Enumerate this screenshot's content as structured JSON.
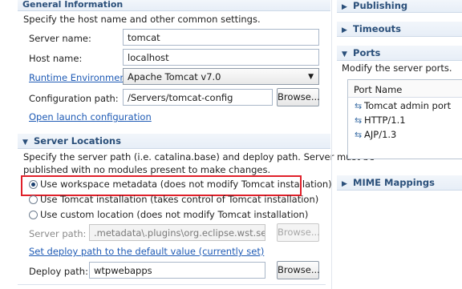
{
  "left": {
    "general": {
      "title": "General Information",
      "description": "Specify the host name and other common settings.",
      "server_name_label": "Server name:",
      "server_name_value": "tomcat",
      "host_name_label": "Host name:",
      "host_name_value": "localhost",
      "runtime_label": "Runtime Environment:",
      "runtime_value": "Apache Tomcat v7.0",
      "config_path_label": "Configuration path:",
      "config_path_value": "/Servers/tomcat-config",
      "browse_label": "Browse...",
      "open_launch_label": "Open launch configuration"
    },
    "locations": {
      "title": "Server Locations",
      "desc_line1": "Specify the server path (i.e. catalina.base) and deploy path. Server must be",
      "desc_line2": "published with no modules present to make changes.",
      "option1": "Use workspace metadata (does not modify Tomcat installation)",
      "option2": "Use Tomcat installation (takes control of Tomcat installation)",
      "option3": "Use custom location (does not modify Tomcat installation)",
      "server_path_label": "Server path:",
      "server_path_value": ".metadata\\.plugins\\org.eclipse.wst.server.co",
      "browse_label": "Browse...",
      "set_deploy_default": "Set deploy path to the default value (currently set)",
      "deploy_path_label": "Deploy path:",
      "deploy_path_value": "wtpwebapps",
      "deploy_browse_label": "Browse..."
    }
  },
  "right": {
    "publishing": "Publishing",
    "timeouts": "Timeouts",
    "ports": {
      "title": "Ports",
      "description": "Modify the server ports.",
      "column_header": "Port Name",
      "rows": [
        "Tomcat admin port",
        "HTTP/1.1",
        "AJP/1.3"
      ]
    },
    "mime": "MIME Mappings"
  }
}
